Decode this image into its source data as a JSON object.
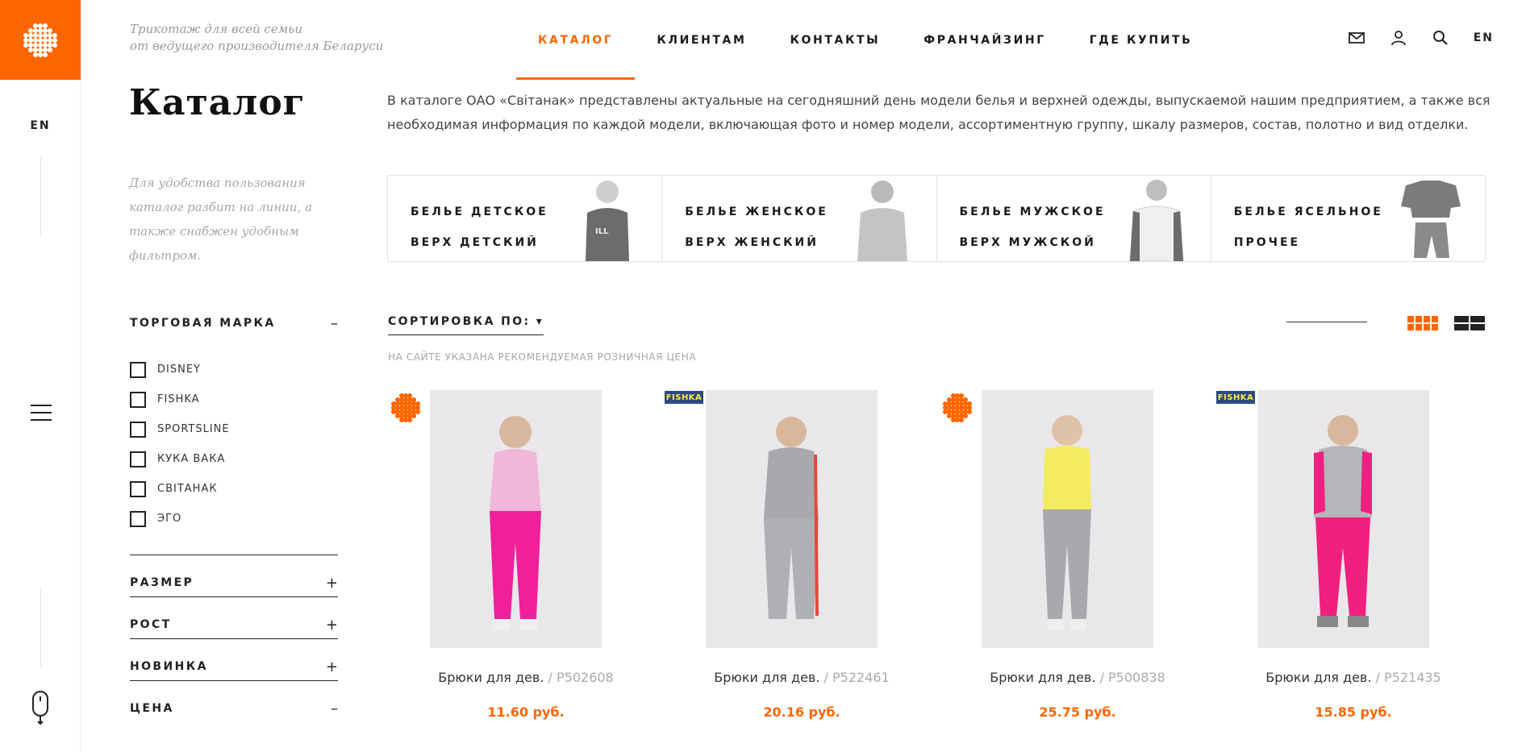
{
  "header": {
    "tagline_line1": "Трикотаж для всей семьи",
    "tagline_line2": "от ведущего производителя Беларуси",
    "nav": [
      {
        "label": "КАТАЛОГ",
        "active": true
      },
      {
        "label": "КЛИЕНТАМ",
        "active": false
      },
      {
        "label": "КОНТАКТЫ",
        "active": false
      },
      {
        "label": "ФРАНЧАЙЗИНГ",
        "active": false
      },
      {
        "label": "ГДЕ КУПИТЬ",
        "active": false
      }
    ],
    "icons": [
      "mail-icon",
      "user-icon",
      "search-icon"
    ],
    "lang": "EN"
  },
  "rail": {
    "lang": "EN",
    "accent": "#ff6600"
  },
  "page": {
    "title": "Каталог",
    "note": "Для удобства пользования каталог разбит на линии, а также снабжен удобным фильтром.",
    "intro": "В каталоге ОАО «Світанак» представлены актуальные на сегодняшний день модели белья и верхней одежды, выпускаемой нашим предприятием, а также вся необходимая информация по каждой модели, включающая фото и номер модели, ассортиментную группу, шкалу размеров, состав, полотно и вид отделки."
  },
  "categories": [
    {
      "line1": "БЕЛЬЕ ДЕТСКОЕ",
      "line2": "ВЕРХ ДЕТСКИЙ"
    },
    {
      "line1": "БЕЛЬЕ ЖЕНСКОЕ",
      "line2": "ВЕРХ ЖЕНСКИЙ"
    },
    {
      "line1": "БЕЛЬЕ МУЖСКОЕ",
      "line2": "ВЕРХ МУЖСКОЙ"
    },
    {
      "line1": "БЕЛЬЕ ЯСЕЛЬНОЕ",
      "line2": "ПРОЧЕЕ"
    }
  ],
  "filters": {
    "brand_title": "ТОРГОВАЯ МАРКА",
    "brand_sign": "–",
    "brands": [
      "DISNEY",
      "FISHKA",
      "SPORTSLINE",
      "КУКА ВАКА",
      "СВІТАНАК",
      "ЭГО"
    ],
    "size_title": "РАЗМЕР",
    "height_title": "РОСТ",
    "new_title": "НОВИНКА",
    "price_title": "ЦЕНА",
    "plus": "+",
    "minus": "–"
  },
  "sort": {
    "label": "СОРТИРОВКА ПО:",
    "arrow": "▾",
    "price_note": "НА САЙТЕ УКАЗАНА РЕКОМЕНДУЕМАЯ РОЗНИЧНАЯ ЦЕНА"
  },
  "products": [
    {
      "name": "Брюки для дев.",
      "article": "/ P502608",
      "price": "11.60 руб.",
      "brand": "svitanak",
      "top": "#f2b6d8",
      "bottom": "#f0209a"
    },
    {
      "name": "Брюки для дев.",
      "article": "/ P522461",
      "price": "20.16 руб.",
      "brand": "fishka",
      "brand_label": "FISHKA",
      "top": "#a8a8ae",
      "bottom": "#b0b0b4"
    },
    {
      "name": "Брюки для дев.",
      "article": "/ P500838",
      "price": "25.75 руб.",
      "brand": "svitanak",
      "top": "#f3ec63",
      "bottom": "#a9a9ad"
    },
    {
      "name": "Брюки для дев.",
      "article": "/ P521435",
      "price": "15.85 руб.",
      "brand": "fishka",
      "brand_label": "FISHKA",
      "top": "#b5b5ba",
      "bottom": "#f0207f"
    }
  ]
}
